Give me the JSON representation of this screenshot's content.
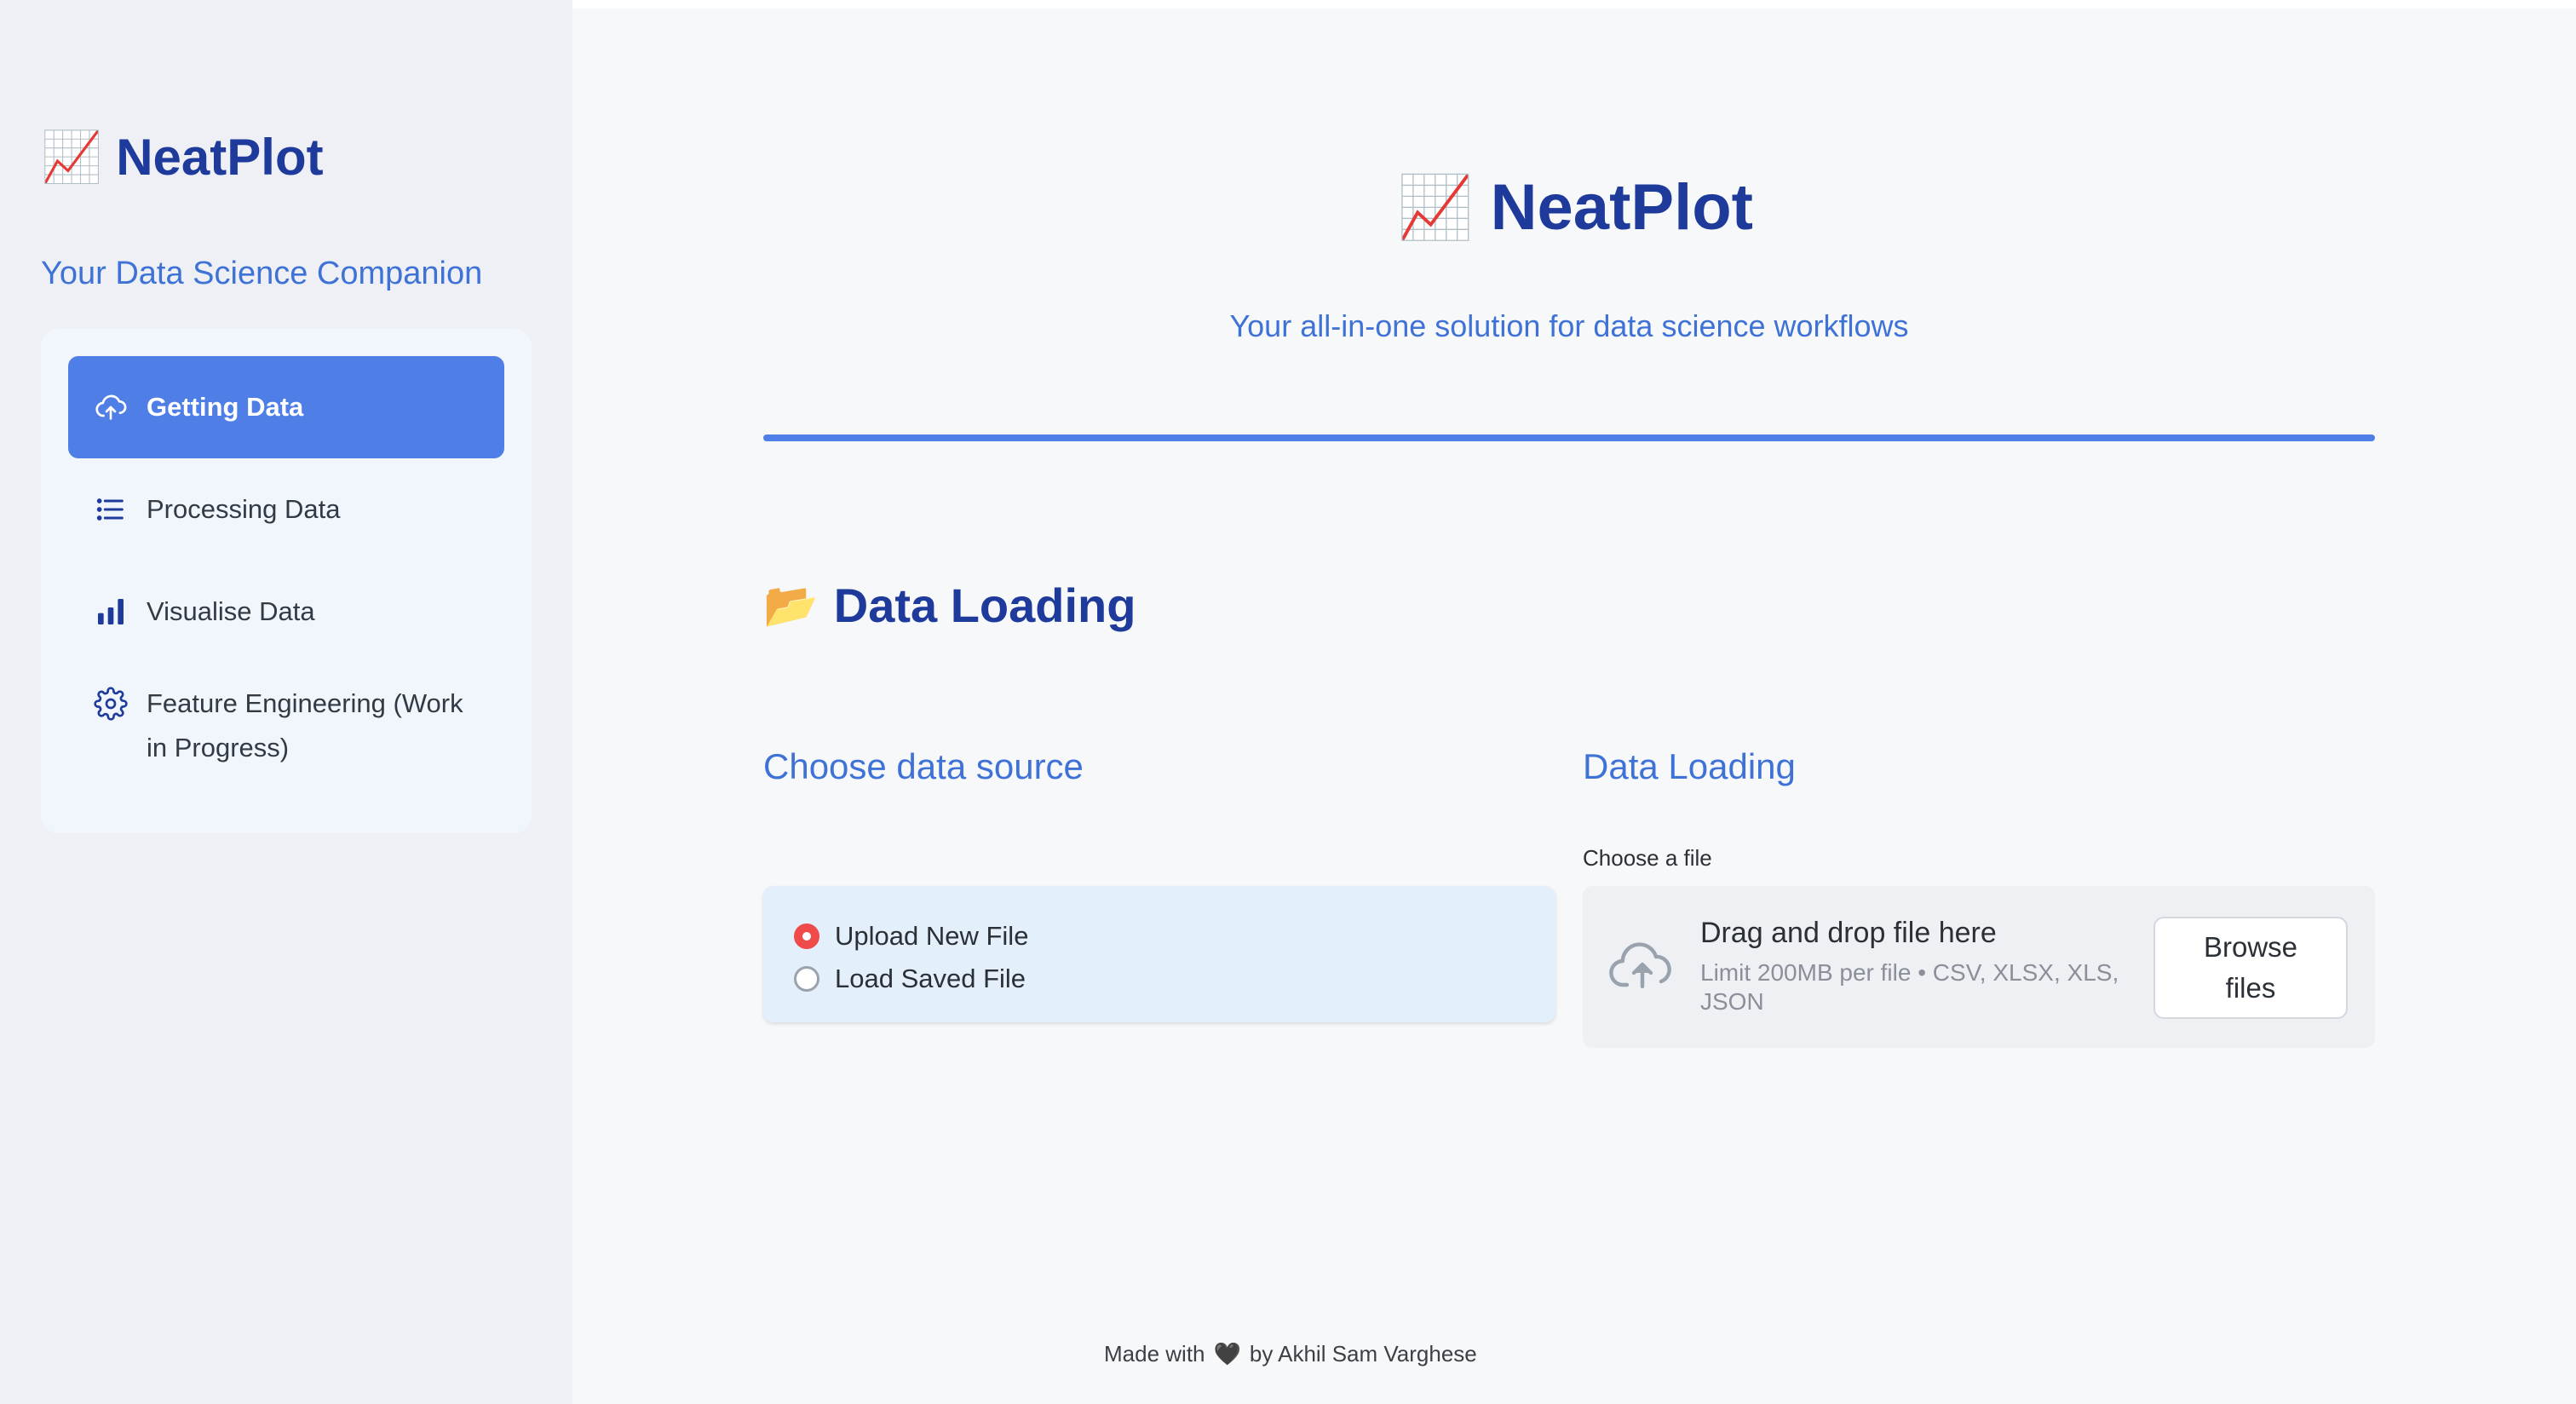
{
  "sidebar": {
    "brand_emoji": "📈",
    "brand_title": "NeatPlot",
    "subtitle": "Your Data Science Companion",
    "items": [
      {
        "label": "Getting Data",
        "icon": "cloud-upload-icon",
        "active": true
      },
      {
        "label": "Processing Data",
        "icon": "list-icon",
        "active": false
      },
      {
        "label": "Visualise Data",
        "icon": "bar-chart-icon",
        "active": false
      },
      {
        "label": "Feature Engineering (Work in Progress)",
        "icon": "gear-icon",
        "active": false
      }
    ]
  },
  "header": {
    "brand_emoji": "📈",
    "title": "NeatPlot",
    "subtitle": "Your all-in-one solution for data science workflows"
  },
  "section": {
    "emoji": "📂",
    "title": "Data Loading"
  },
  "left_column": {
    "title": "Choose data source",
    "options": [
      {
        "label": "Upload New File",
        "selected": true
      },
      {
        "label": "Load Saved File",
        "selected": false
      }
    ]
  },
  "right_column": {
    "title": "Data Loading",
    "file_label": "Choose a file",
    "dropzone_main": "Drag and drop file here",
    "dropzone_sub": "Limit 200MB per file • CSV, XLSX, XLS, JSON",
    "browse_label": "Browse files"
  },
  "footer": {
    "prefix": "Made with",
    "heart": "🖤",
    "suffix": "by Akhil Sam Varghese"
  },
  "colors": {
    "accent": "#4f7fe6",
    "brand": "#1e3a9a",
    "subtitle": "#3f72d6",
    "radio_selected": "#ef4b4b"
  }
}
